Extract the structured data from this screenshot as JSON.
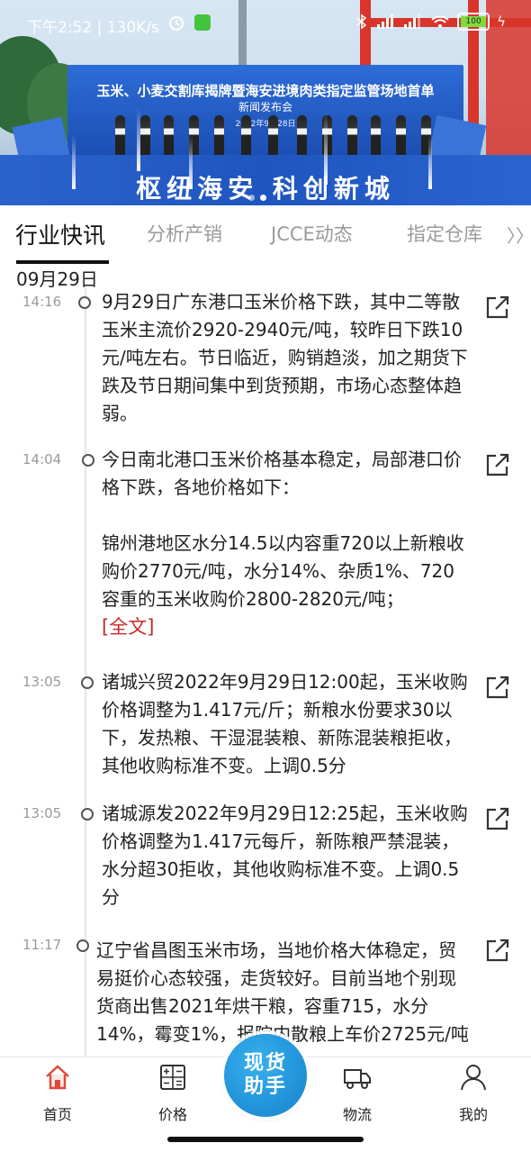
{
  "status_bar": {
    "time": "下午2:52 | 130K/s",
    "battery": "100"
  },
  "banner": {
    "backdrop_title": "玉米、小麦交割库揭牌暨海安进境肉类指定监管场地首单",
    "backdrop_subtitle": "新闻发布会",
    "backdrop_date": "2022年9月28日",
    "slogan": "枢纽海安 科创新城"
  },
  "tabs": [
    {
      "label": "行业快讯",
      "active": true
    },
    {
      "label": "分析产销",
      "active": false
    },
    {
      "label": "JCCE动态",
      "active": false
    },
    {
      "label": "指定仓库",
      "active": false
    }
  ],
  "tab_more": "〉〉",
  "feed": {
    "date": "09月29日",
    "entries": [
      {
        "time": "14:16",
        "paragraphs": [
          "9月29日广东港口玉米价格下跌，其中二等散玉米主流价2920-2940元/吨，较昨日下跌10元/吨左右。节日临近，购销趋淡，加之期货下跌及节日期间集中到货预期，市场心态整体趋弱。"
        ]
      },
      {
        "time": "14:04",
        "paragraphs": [
          "今日南北港口玉米价格基本稳定，局部港口价格下跌，各地价格如下：",
          "锦州港地区水分14.5以内容重720以上新粮收购价2770元/吨，水分14%、杂质1%、720容重的玉米收购价2800-2820元/吨；"
        ],
        "link": "[全文]"
      },
      {
        "time": "13:05",
        "paragraphs": [
          "诸城兴贸2022年9月29日12:00起，玉米收购价格调整为1.417元/斤；新粮水份要求30以下，发热粮、干湿混装粮、新陈混装粮拒收，其他收购标准不变。上调0.5分"
        ]
      },
      {
        "time": "13:05",
        "paragraphs": [
          "诸城源发2022年9月29日12:25起，玉米收购价格调整为1.417元每斤，新陈粮严禁混装，水分超30拒收，其他收购标准不变。上调0.5分"
        ]
      },
      {
        "time": "11:17",
        "paragraphs": [
          "辽宁省昌图玉米市场，当地价格大体稳定，贸易挺价心态较强，走货较好。目前当地个别现货商出售2021年烘干粮，容重715，水分14%，霉变1%，报院内散粮上车价2725元/吨"
        ]
      }
    ]
  },
  "bottom_nav": {
    "items": [
      {
        "label": "首页",
        "icon": "home-icon"
      },
      {
        "label": "价格",
        "icon": "calculator-icon"
      },
      {
        "label": "物流",
        "icon": "truck-icon"
      },
      {
        "label": "我的",
        "icon": "user-icon"
      }
    ],
    "center": {
      "line1": "现货",
      "line2": "助手"
    }
  },
  "colors": {
    "accent_red": "#c62828",
    "home_icon_red": "#e0473a",
    "center_button_blue": "#1f8fd6"
  }
}
